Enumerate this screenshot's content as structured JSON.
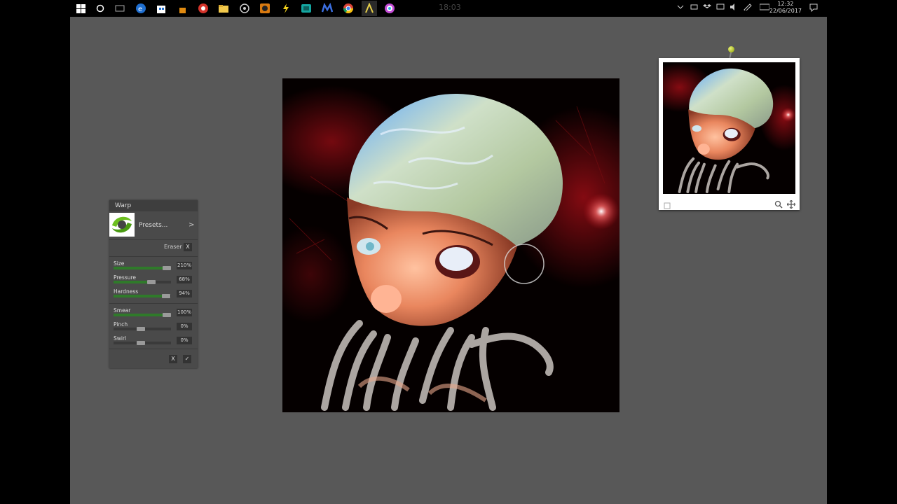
{
  "taskbar": {
    "center_time": "18:03",
    "clock_time": "12:32",
    "clock_date": "22/06/2017",
    "apps": [
      "start-icon",
      "cortana-icon",
      "task-view-icon",
      "edge-icon",
      "store-icon",
      "app-icon",
      "browser-icon",
      "file-explorer-icon",
      "app-icon",
      "app-icon",
      "app-icon",
      "app-icon",
      "app-icon",
      "chrome-icon",
      "artrage-icon",
      "app-icon"
    ]
  },
  "warp_panel": {
    "title": "Warp",
    "presets_label": "Presets...",
    "presets_arrow": ">",
    "eraser_label": "Eraser",
    "eraser_close": "X",
    "sliders": [
      {
        "label": "Size",
        "value": "210%",
        "level": 0.95
      },
      {
        "label": "Pressure",
        "value": "68%",
        "level": 0.68
      },
      {
        "label": "Hardness",
        "value": "94%",
        "level": 0.94
      },
      {
        "label": "Smear",
        "value": "100%",
        "level": 1.0
      },
      {
        "label": "Pinch",
        "value": "0%",
        "level": 0.5
      },
      {
        "label": "Swirl",
        "value": "0%",
        "level": 0.5
      }
    ],
    "cancel_label": "X",
    "ok_label": "✓"
  },
  "colors": {
    "workspace": "#585858",
    "slider_fill": "#2f7a2a",
    "canvas_bg": "#000000",
    "accent_red": "#c0101a"
  }
}
